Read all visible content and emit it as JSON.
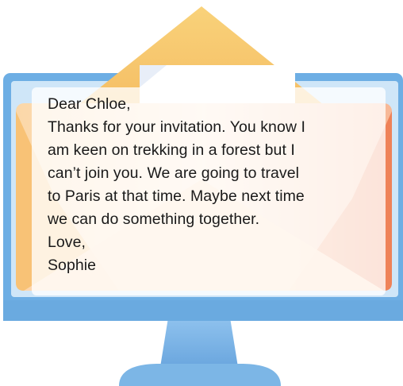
{
  "illustration": {
    "monitor_icon": "computer-monitor-icon",
    "envelope_icon": "envelope-icon",
    "colors": {
      "monitor_frame": "#6eb0e4",
      "monitor_stand": "#78b4e8",
      "envelope_top": "#f5c56a",
      "envelope_side_left": "#f7c06a",
      "envelope_side_right": "#f08a5a",
      "paper": "#ffffff"
    }
  },
  "letter": {
    "greeting": "Dear Chloe,",
    "body_lines": [
      "Thanks for your invitation. You know I",
      "am keen on trekking in a forest but I",
      "can’t join you. We are going to travel",
      "to Paris at that time. Maybe next time",
      "we can do something  together."
    ],
    "closing": "Love,",
    "signature": "Sophie"
  }
}
